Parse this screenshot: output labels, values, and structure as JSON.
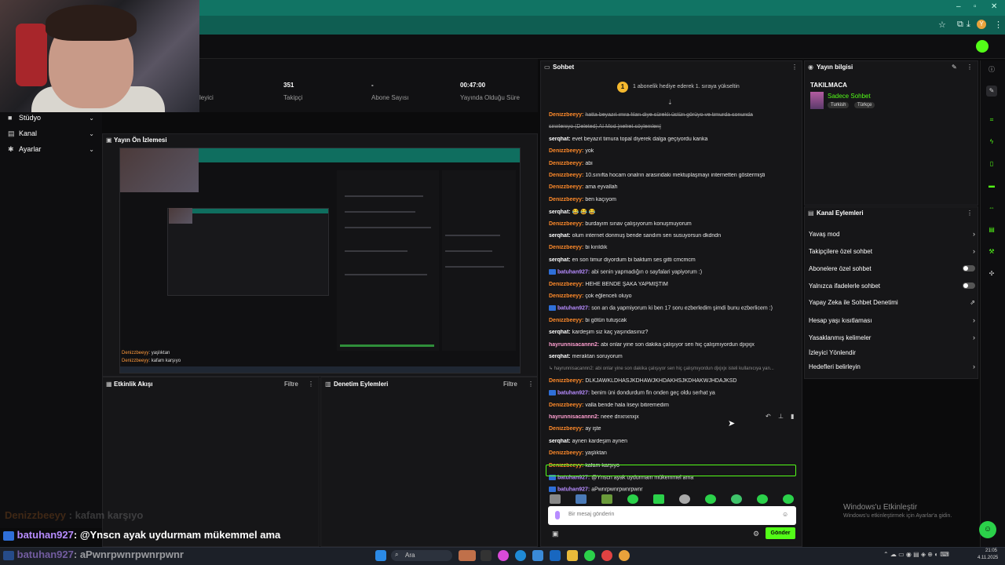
{
  "window": {
    "controls": [
      "–",
      "▫",
      "✕"
    ]
  },
  "stats": [
    {
      "value": "",
      "label": "leyici"
    },
    {
      "value": "351",
      "label": "Takipçi"
    },
    {
      "value": "-",
      "label": "Abone Sayısı"
    },
    {
      "value": "00:47:00",
      "label": "Yayında Olduğu Süre"
    }
  ],
  "nav": [
    {
      "label": "Stüdyo",
      "icon": "studio-icon"
    },
    {
      "label": "Kanal",
      "icon": "channel-icon"
    },
    {
      "label": "Ayarlar",
      "icon": "settings-icon"
    }
  ],
  "preview": {
    "title": "Yayın Ön İzlemesi",
    "captions": [
      {
        "user": "Denizzbeeyy",
        "text": ": yaşlıktan"
      },
      {
        "user": "Denizzbeeyy",
        "text": ": kafam karşıyo"
      }
    ]
  },
  "activity": {
    "title": "Etkinlik Akışı",
    "filter": "Filtre"
  },
  "moderation": {
    "title": "Denetim Eylemleri",
    "filter": "Filtre"
  },
  "chat": {
    "title": "Sohbet",
    "gift_banner": "1 abonelik hediye ederek 1. sıraya yükseltin",
    "messages": [
      {
        "user": "Denizzbeeyy",
        "color": "orange",
        "text": "hatta beyazıt ımra filan diye sürekli üstün görüyo ve timurda sonunda",
        "deleted": true
      },
      {
        "user": "",
        "color": "white",
        "text": "sinirleniyo (Deleted) AI Mod [nefret söylemleri]",
        "cont": true
      },
      {
        "user": "serqhat",
        "color": "white",
        "text": "evet beyazıt timura topal diyerek dalga geçiyordu kanka"
      },
      {
        "user": "Denizzbeeyy",
        "color": "orange",
        "text": "yok"
      },
      {
        "user": "Denizzbeeyy",
        "color": "orange",
        "text": "abi"
      },
      {
        "user": "Denizzbeeyy",
        "color": "orange",
        "text": "10.sınıfta hocam onalrın arasındaki mektuplaşmayı internetten göstermişti"
      },
      {
        "user": "Denizzbeeyy",
        "color": "orange",
        "text": "ama eyvallah"
      },
      {
        "user": "Denizzbeeyy",
        "color": "orange",
        "text": "ben kaçıyom"
      },
      {
        "user": "serqhat",
        "color": "white",
        "text": "😂 😂 😂"
      },
      {
        "user": "Denizzbeeyy",
        "color": "orange",
        "text": "burdayım sınav çalışıyorum konuşmuyorum"
      },
      {
        "user": "serqhat",
        "color": "white",
        "text": "olum internet donmuş bende sandım sen susuyorsun dkdndn"
      },
      {
        "user": "Denizzbeeyy",
        "color": "orange",
        "text": "bi kırıldık"
      },
      {
        "user": "serqhat",
        "color": "white",
        "text": "en son timur diyordum bi baktum ses gitti cmcmcm"
      },
      {
        "user": "batuhan927",
        "color": "purple",
        "text": "abi senin yapmadığın o sayfalari yapiyorum :)",
        "badge": true
      },
      {
        "user": "Denizzbeeyy",
        "color": "orange",
        "text": "HEHE BENDE ŞAKA YAPMIŞTIM"
      },
      {
        "user": "Denizzbeeyy",
        "color": "orange",
        "text": "çok eğlenceli oluyo"
      },
      {
        "user": "batuhan927",
        "color": "purple",
        "text": "son an da yapmiyorum ki ben 17 soru ezberledim şimdi bunu ezberlicem :)",
        "badge": true
      },
      {
        "user": "Denizzbeeyy",
        "color": "orange",
        "text": "bi götün tutuşcak"
      },
      {
        "user": "serqhat",
        "color": "white",
        "text": "kardeşim siz kaç yaşındasınız?"
      },
      {
        "user": "hayrunnisacannn2",
        "color": "pink",
        "text": "abi onlar yine son dakika çalışıyor sen hiç çalışmıyordun djxjxjx"
      },
      {
        "user": "serqhat",
        "color": "white",
        "text": "meraktan soruyorum"
      },
      {
        "user": "",
        "color": "white",
        "text": "↳ hayrunnisacannn2: abi onlar yine son dakika çalışıyor sen hiç çalışmıyordun djxjxjx isteli kullanıcıya yan...",
        "reply": true
      },
      {
        "user": "Denizzbeeyy",
        "color": "orange",
        "text": "DLKJAWKLDHASJKDHAWJKHDAKHSJKDHAKWJHDAJKSD"
      },
      {
        "user": "batuhan927",
        "color": "purple",
        "text": "benim üni dondurdum fin onden geç oldu serhat ya",
        "badge": true
      },
      {
        "user": "Denizzbeeyy",
        "color": "orange",
        "text": "valla bende hala liseyi bitiremedim"
      },
      {
        "user": "hayrunnisacannn2",
        "color": "pink",
        "text": "neee dnxnxnxjx"
      },
      {
        "user": "Denizzbeeyy",
        "color": "orange",
        "text": "ay işte"
      },
      {
        "user": "serqhat",
        "color": "white",
        "text": "aynen kardeşim aynen"
      },
      {
        "user": "Denizzbeeyy",
        "color": "orange",
        "text": "yaşlıktan"
      },
      {
        "user": "Denizzbeeyy",
        "color": "orange",
        "text": "kafam karşıyo"
      },
      {
        "user": "batuhan927",
        "color": "purple",
        "text": "@Ynscn ayak uydurmam mükemmel ama",
        "badge": true,
        "highlight": true
      },
      {
        "user": "batuhan927",
        "color": "purple",
        "text": "aPwnrpwnrpwnrpwnr",
        "badge": true
      }
    ],
    "input_placeholder": "Bir mesaj gönderin",
    "send_label": "Gönder"
  },
  "stream_info": {
    "title": "Yayın bilgisi",
    "stream_title": "TAKILMACA",
    "category": "Sadece Sohbet",
    "tags": [
      "Turkish",
      "Türkçe"
    ]
  },
  "channel_actions": {
    "title": "Kanal Eylemleri",
    "items": [
      {
        "label": "Yavaş mod",
        "kind": "chevron"
      },
      {
        "label": "Takipçilere özel sohbet",
        "kind": "chevron"
      },
      {
        "label": "Abonelere özel sohbet",
        "kind": "toggle"
      },
      {
        "label": "Yalnızca ifadelerle sohbet",
        "kind": "toggle"
      },
      {
        "label": "Yapay Zeka ile Sohbet Denetimi",
        "kind": "link"
      },
      {
        "label": "Hesap yaşı kısıtlaması",
        "kind": "chevron"
      },
      {
        "label": "Yasaklanmış kelimeler",
        "kind": "chevron"
      },
      {
        "label": "İzleyici Yönlendir",
        "kind": "none"
      },
      {
        "label": "Hedefleri belirleyin",
        "kind": "chevron"
      }
    ]
  },
  "windows_notice": {
    "title": "Windows'u Etkinleştir",
    "subtitle": "Windows'u etkinleştirmek için Ayarlar'a gidin."
  },
  "overlay": [
    {
      "user": "Denizzbeeyy",
      "text": " : kafam karşıyo",
      "faded": true
    },
    {
      "user": "batuhan927",
      "text": ": @Ynscn ayak uydurmam mükemmel ama"
    },
    {
      "user": "batuhan927",
      "text": ": aPwnrpwnrpwnrpwnr"
    }
  ],
  "taskbar": {
    "search": "Ara",
    "clock": "21:05",
    "date": "4.11.2025"
  },
  "colors": {
    "accent": "#53fc18",
    "brand": "#117464",
    "orange": "#ff8a2a",
    "purple": "#b78cff"
  }
}
